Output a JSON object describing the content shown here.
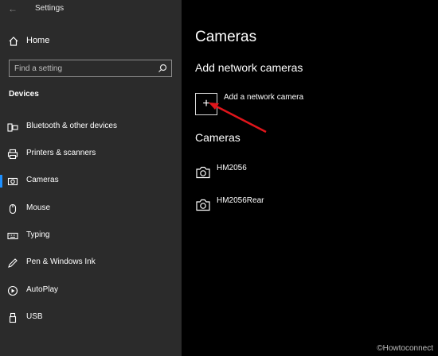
{
  "window": {
    "title": "Settings"
  },
  "sidebar": {
    "home_label": "Home",
    "search_placeholder": "Find a setting",
    "section_label": "Devices",
    "items": [
      {
        "label": "Bluetooth & other devices",
        "icon": "bluetooth-devices-icon"
      },
      {
        "label": "Printers & scanners",
        "icon": "printer-icon"
      },
      {
        "label": "Cameras",
        "icon": "camera-icon",
        "selected": true
      },
      {
        "label": "Mouse",
        "icon": "mouse-icon"
      },
      {
        "label": "Typing",
        "icon": "keyboard-icon"
      },
      {
        "label": "Pen & Windows Ink",
        "icon": "pen-icon"
      },
      {
        "label": "AutoPlay",
        "icon": "autoplay-icon"
      },
      {
        "label": "USB",
        "icon": "usb-icon"
      }
    ]
  },
  "main": {
    "title": "Cameras",
    "add_section_title": "Add network cameras",
    "add_button_symbol": "+",
    "add_label": "Add a network camera",
    "cameras_section_title": "Cameras",
    "cameras": [
      {
        "name": "HM2056"
      },
      {
        "name": "HM2056Rear"
      }
    ]
  },
  "watermark": "©Howtoconnect",
  "colors": {
    "accent": "#1e90ff",
    "annotation_arrow": "#e0151b",
    "sidebar_bg": "#2b2b2b",
    "main_bg": "#000000"
  }
}
